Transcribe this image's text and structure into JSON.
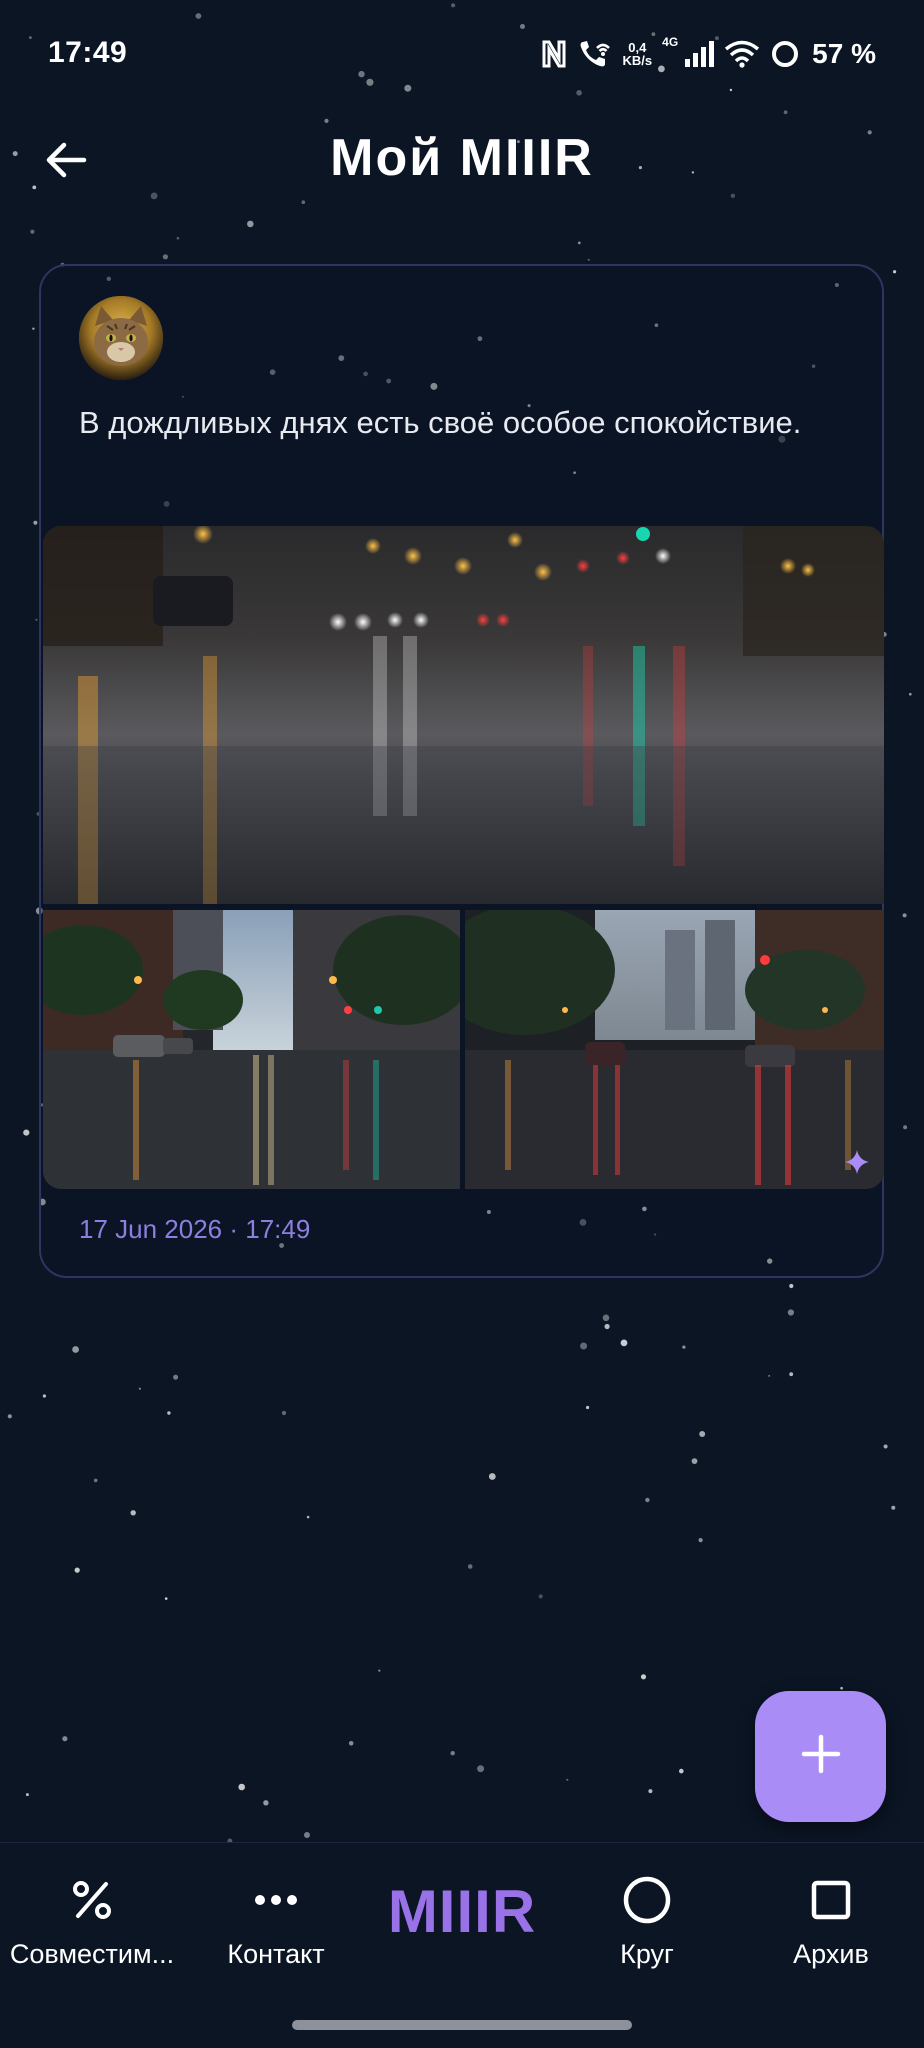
{
  "status_bar": {
    "time": "17:49",
    "net_speed_value": "0,4",
    "net_speed_unit": "KB/s",
    "network_type": "4G",
    "battery_percent": "57 %"
  },
  "header": {
    "title": "Мой MIIIR"
  },
  "post": {
    "text": "В дождливых днях есть своё особое спокойствие.",
    "timestamp": "17 Jun 2026 · 17:49"
  },
  "bottom_nav": {
    "items": [
      {
        "label": "Совместим...",
        "icon": "percent-icon"
      },
      {
        "label": "Контакт",
        "icon": "more-dots-icon"
      },
      {
        "label": "Круг",
        "icon": "circle-icon"
      },
      {
        "label": "Архив",
        "icon": "square-icon"
      }
    ],
    "logo": "MIIIR"
  },
  "colors": {
    "background": "#0b1524",
    "accent": "#a98cf5",
    "logo": "#9a72e8",
    "timestamp": "#8d7fe0",
    "card_border": "#2e3560"
  }
}
